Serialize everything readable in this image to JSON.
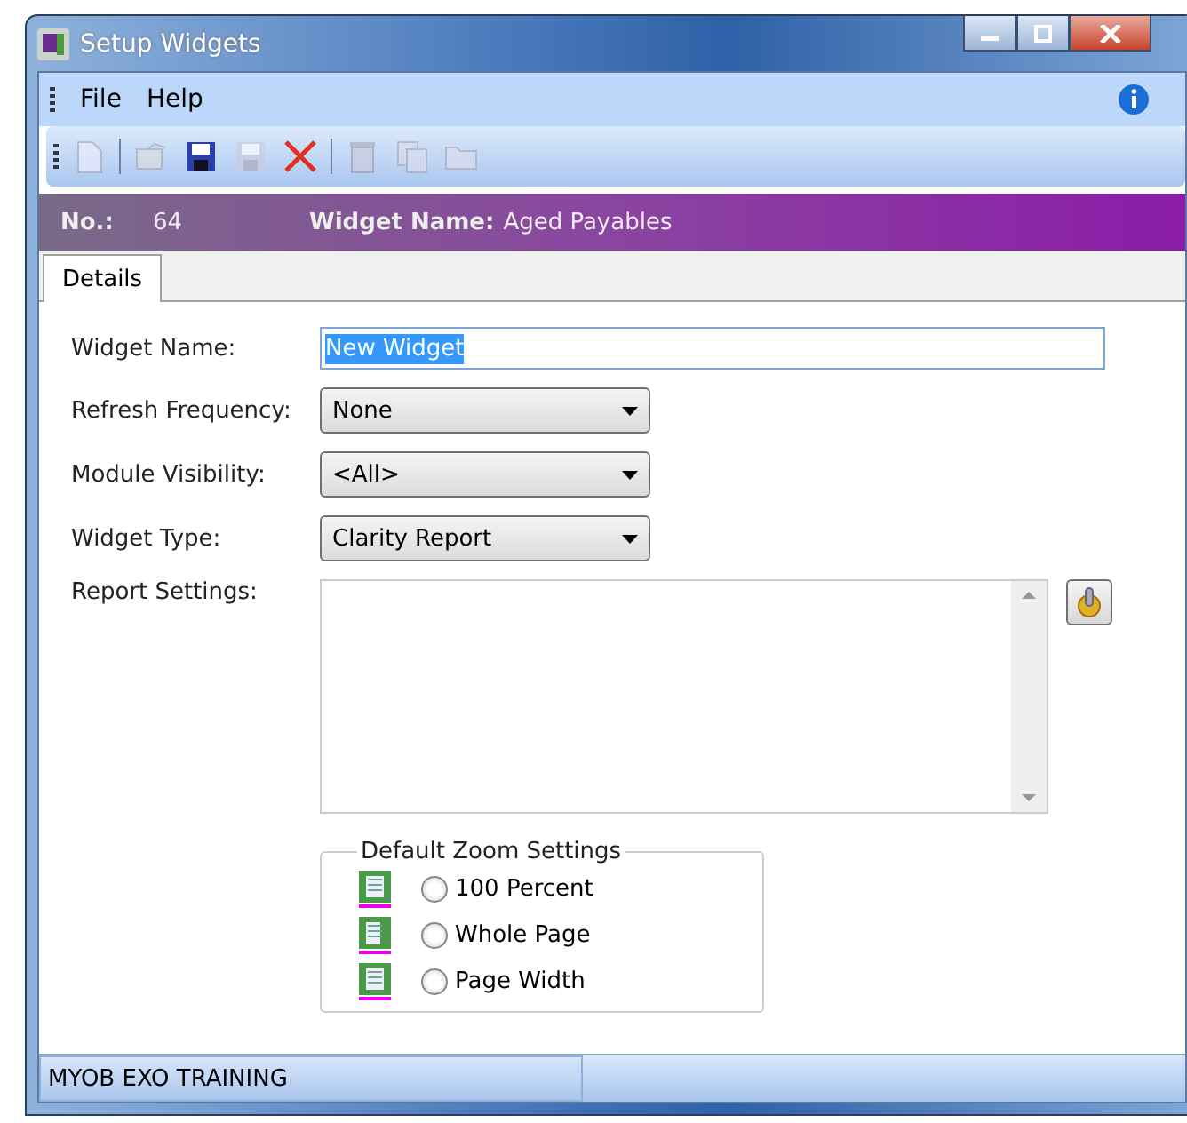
{
  "window": {
    "title": "Setup Widgets"
  },
  "menu": [
    "File",
    "Help"
  ],
  "toolbar": [
    {
      "kind": "new",
      "disabled": true
    },
    {
      "kind": "sep"
    },
    {
      "kind": "properties",
      "disabled": true
    },
    {
      "kind": "save",
      "disabled": false
    },
    {
      "kind": "save",
      "disabled": true
    },
    {
      "kind": "delete",
      "disabled": false
    },
    {
      "kind": "sep"
    },
    {
      "kind": "trash",
      "disabled": true
    },
    {
      "kind": "copy",
      "disabled": true
    },
    {
      "kind": "open",
      "disabled": true
    }
  ],
  "header": {
    "no_label": "No.:",
    "no_value": "64",
    "name_label": "Widget Name:",
    "name_value": "Aged Payables"
  },
  "tabs": [
    {
      "label": "Details",
      "selected": true
    }
  ],
  "form": {
    "widget_name": {
      "label": "Widget Name:",
      "value": "New Widget"
    },
    "dropdowns": [
      {
        "label": "Refresh Frequency:",
        "value": "None"
      },
      {
        "label": "Module Visibility:",
        "value": "<All>"
      },
      {
        "label": "Widget Type:",
        "value": "Clarity Report"
      }
    ],
    "report_settings": {
      "label": "Report Settings:"
    }
  },
  "zoom": {
    "title": "Default Zoom Settings",
    "options": [
      {
        "label": "100 Percent",
        "selected": false
      },
      {
        "label": "Whole Page",
        "selected": false
      },
      {
        "label": "Page Width",
        "selected": false
      }
    ]
  },
  "status_bar": [
    "MYOB EXO TRAINING"
  ]
}
